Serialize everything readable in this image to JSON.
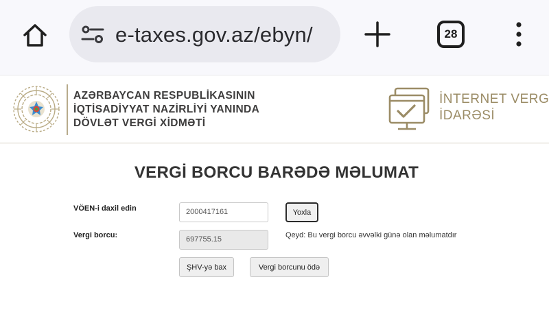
{
  "browser": {
    "url": "e-taxes.gov.az/ebyn/",
    "tab_count": "28"
  },
  "header": {
    "org_lines": [
      "AZƏRBAYCAN RESPUBLİKASININ",
      "İQTİSADİYYAT NAZİRLİYİ YANINDA",
      "DÖVLƏT VERGİ XİDMƏTİ"
    ],
    "service_lines": [
      "İNTERNET VERGİ",
      "İDARƏSİ"
    ]
  },
  "main": {
    "title": "VERGİ BORCU BARƏDƏ MƏLUMAT",
    "voen_label": "VÖEN-i daxil edin",
    "voen_value": "2000417161",
    "check_button": "Yoxla",
    "debt_label": "Vergi borcu:",
    "debt_value": "697755.15",
    "note": "Qeyd: Bu vergi borcu əvvəlki günə olan məlumatdır",
    "shv_button": "ŞHV-yə bax",
    "pay_button": "Vergi borcunu ödə"
  },
  "icons": {
    "home": "home-icon",
    "site_settings": "tune-icon",
    "new_tab": "plus-icon",
    "tabs": "tab-switcher-icon",
    "menu": "more-vert-icon",
    "emblem": "state-emblem-icon",
    "monitor": "monitor-check-icon"
  },
  "colors": {
    "brand_gold": "#9b8c66",
    "header_text": "#3e3d3d",
    "urlbar_bg": "#e9e9ef"
  }
}
